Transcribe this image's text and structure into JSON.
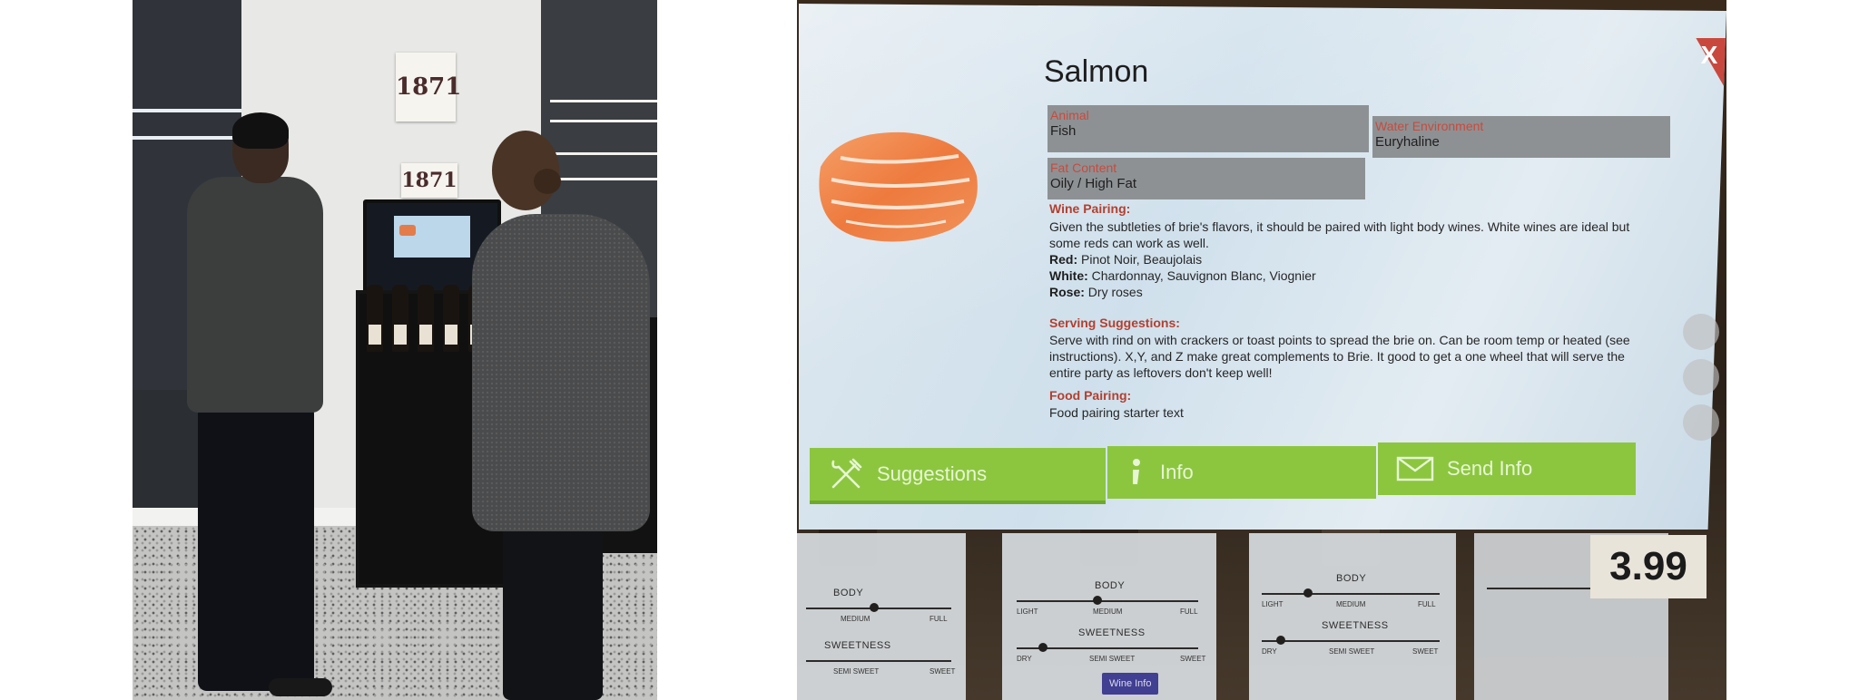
{
  "left_photo": {
    "sign_top": "1871",
    "sign_bottom": "1871"
  },
  "kiosk": {
    "title": "Salmon",
    "close_label": "X",
    "attributes": {
      "animal": {
        "label": "Animal",
        "value": "Fish"
      },
      "water": {
        "label": "Water Environment",
        "value": "Euryhaline"
      },
      "fat": {
        "label": "Fat Content",
        "value": "Oily / High Fat"
      }
    },
    "wine_pairing": {
      "heading": "Wine Pairing:",
      "line1": "Given the subtleties of brie's flavors, it should be paired with light body wines. White wines are ideal but",
      "line2": "some reds can work as well.",
      "red_label": "Red:",
      "red_value": "Pinot Noir, Beaujolais",
      "white_label": "White:",
      "white_value": "Chardonnay, Sauvignon Blanc, Viognier",
      "rose_label": "Rose:",
      "rose_value": "Dry roses"
    },
    "serving": {
      "heading": "Serving Suggestions:",
      "line1": "Serve with rind on with crackers or toast points to spread the brie on. Can be room temp or heated (see",
      "line2": "instructions). X,Y, and Z make great complements to Brie. It good to get a one wheel that will serve the",
      "line3": "entire party as leftovers don't keep well!"
    },
    "food": {
      "heading": "Food Pairing:",
      "text": "Food pairing starter text"
    },
    "buttons": {
      "suggestions": "Suggestions",
      "info": "Info",
      "send_info": "Send Info"
    },
    "colors": {
      "button_green": "#8cc63f",
      "label_red": "#c94a3c",
      "close_red": "#c9483e"
    },
    "icons": {
      "suggestions": "fork-knife-icon",
      "info": "info-icon",
      "send_info": "envelope-icon"
    }
  },
  "lower_cards": {
    "body_label": "BODY",
    "sweetness_label": "SWEETNESS",
    "light": "LIGHT",
    "medium": "MEDIUM",
    "full": "FULL",
    "dry": "DRY",
    "semi_sweet": "SEMI SWEET",
    "sweet": "SWEET",
    "wine_info": "Wine Info",
    "price": "3.99"
  }
}
